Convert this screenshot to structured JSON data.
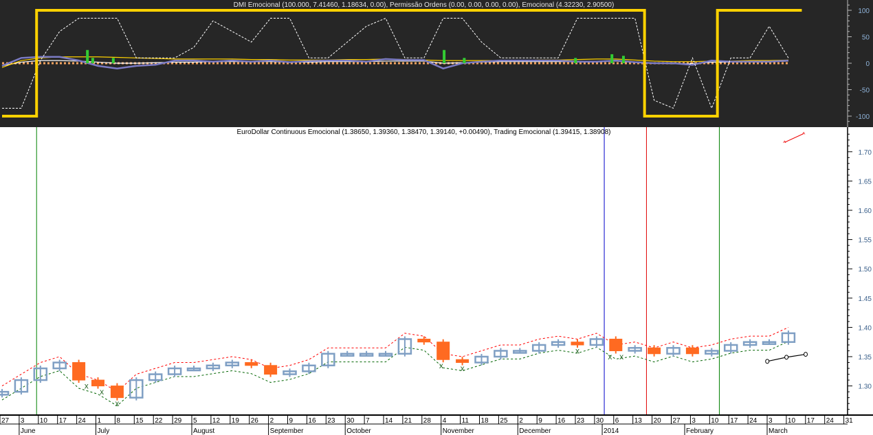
{
  "top_panel": {
    "title": "DMI Emocional (100.000, 7.41460, 1.18634, 0.00), Permissão Ordens (0.00, 0.00, 0.00, 0.00), Emocional (4.32230, 2.90500)"
  },
  "main_panel": {
    "title": "EuroDollar Continuous Emocional (1.38650, 1.39360, 1.38470, 1.39140, +0.00490), Trading Emocional (1.39415, 1.38908)"
  },
  "colors": {
    "dark_bg": "#262626",
    "yellow": "#ffd200",
    "purple": "#7b7bc4",
    "green_bar": "#33cc33",
    "up_candle": "#7f9fc4",
    "down_candle": "#ff6a21",
    "upper_band": "#ff0000",
    "lower_band": "#006400",
    "orange_dots": "#f4a460"
  },
  "chart_data": [
    {
      "type": "line",
      "panel": "indicator",
      "title": "DMI Emocional (100.000, 7.41460, 1.18634, 0.00), Permissão Ordens (0.00, 0.00, 0.00, 0.00), Emocional (4.32230, 2.90500)",
      "ylim": [
        -115,
        115
      ],
      "yticks": [
        "100",
        "50",
        "0",
        "-50",
        "-100"
      ],
      "ytick_values": [
        100,
        50,
        0,
        -50,
        -100
      ],
      "x_unit": "week index from May 27, 2013",
      "series": [
        {
          "name": "Permissão Ordens (step)",
          "segments": [
            {
              "from": 0,
              "to": 1.8,
              "value": -100
            },
            {
              "from": 1.8,
              "to": 33.5,
              "value": 100
            },
            {
              "from": 33.5,
              "to": 37.3,
              "value": -100
            },
            {
              "from": 37.3,
              "to": 41.7,
              "value": 100
            }
          ]
        },
        {
          "name": "DMI dashed",
          "values": [
            -85,
            -85,
            5,
            60,
            85,
            85,
            85,
            10,
            10,
            10,
            30,
            80,
            60,
            40,
            85,
            85,
            10,
            10,
            40,
            70,
            85,
            10,
            10,
            85,
            85,
            40,
            10,
            10,
            10,
            10,
            85,
            85,
            85,
            85,
            -70,
            -85,
            10,
            -85,
            10,
            10,
            70,
            10
          ]
        },
        {
          "name": "Emocional purple",
          "values": [
            -5,
            10,
            12,
            12,
            5,
            -5,
            -10,
            -5,
            -3,
            5,
            5,
            3,
            5,
            3,
            5,
            2,
            4,
            5,
            5,
            3,
            8,
            6,
            6,
            -10,
            0,
            3,
            5,
            5,
            5,
            5,
            3,
            3,
            5,
            2,
            0,
            0,
            -3,
            5,
            3,
            3,
            3,
            5
          ]
        },
        {
          "name": "Emocional yellow",
          "values": [
            -8,
            5,
            10,
            12,
            12,
            12,
            11,
            10,
            9,
            8,
            8,
            8,
            8,
            7,
            7,
            6,
            6,
            6,
            7,
            7,
            8,
            7,
            6,
            5,
            5,
            5,
            5,
            5,
            6,
            6,
            7,
            8,
            8,
            6,
            4,
            3,
            3,
            4,
            4,
            5,
            5,
            6
          ]
        },
        {
          "name": "Emocional white",
          "values": [
            -5,
            2,
            5,
            5,
            4,
            2,
            0,
            0,
            1,
            2,
            2,
            3,
            3,
            3,
            3,
            2,
            2,
            3,
            3,
            3,
            4,
            4,
            4,
            0,
            1,
            2,
            3,
            3,
            3,
            3,
            3,
            3,
            4,
            2,
            0,
            -1,
            -1,
            2,
            2,
            2,
            3,
            4
          ]
        },
        {
          "name": "Zero dotted",
          "values": [
            0,
            0,
            0,
            0,
            0,
            0,
            0,
            0,
            0,
            0,
            0,
            0,
            0,
            0,
            0,
            0,
            0,
            0,
            0,
            0,
            0,
            0,
            0,
            0,
            0,
            0,
            0,
            0,
            0,
            0,
            0,
            0,
            0,
            0,
            0,
            0,
            0,
            0,
            0,
            0,
            0,
            0
          ]
        }
      ],
      "bars": [
        {
          "x": 4.45,
          "value": 25
        },
        {
          "x": 4.73,
          "value": 10
        },
        {
          "x": 5.8,
          "value": 10
        },
        {
          "x": 23.05,
          "value": 25
        },
        {
          "x": 24.1,
          "value": 10
        },
        {
          "x": 29.9,
          "value": 10
        },
        {
          "x": 31.8,
          "value": 17
        },
        {
          "x": 32.4,
          "value": 14
        }
      ]
    },
    {
      "type": "bar",
      "panel": "price",
      "title": "EuroDollar Continuous Emocional (1.38650, 1.39360, 1.38470, 1.39140, +0.00490), Trading Emocional (1.39415, 1.38908)",
      "ylim": [
        1.245,
        1.745
      ],
      "yticks": [
        "1.70",
        "1.65",
        "1.60",
        "1.55",
        "1.50",
        "1.45",
        "1.40",
        "1.35",
        "1.30"
      ],
      "ytick_values": [
        1.7,
        1.65,
        1.6,
        1.55,
        1.5,
        1.45,
        1.4,
        1.35,
        1.3
      ],
      "x_ticks": [
        "27",
        "3",
        "10",
        "17",
        "24",
        "1",
        "8",
        "15",
        "22",
        "29",
        "5",
        "12",
        "19",
        "26",
        "2",
        "9",
        "16",
        "23",
        "30",
        "7",
        "14",
        "21",
        "28",
        "4",
        "11",
        "18",
        "25",
        "2",
        "9",
        "16",
        "23",
        "30",
        "6",
        "13",
        "20",
        "27",
        "3",
        "10",
        "17",
        "24",
        "3",
        "10",
        "17",
        "24",
        "31"
      ],
      "months": [
        {
          "label": "June",
          "week": 1
        },
        {
          "label": "July",
          "week": 5
        },
        {
          "label": "August",
          "week": 10
        },
        {
          "label": "September",
          "week": 14
        },
        {
          "label": "October",
          "week": 18
        },
        {
          "label": "November",
          "week": 23
        },
        {
          "label": "December",
          "week": 27
        },
        {
          "label": "2014",
          "week": 31.4
        },
        {
          "label": "February",
          "week": 35.7
        },
        {
          "label": "March",
          "week": 40
        }
      ],
      "closes": [
        1.29,
        1.31,
        1.33,
        1.34,
        1.31,
        1.3,
        1.28,
        1.31,
        1.32,
        1.33,
        1.33,
        1.335,
        1.34,
        1.335,
        1.32,
        1.325,
        1.335,
        1.355,
        1.355,
        1.355,
        1.355,
        1.38,
        1.375,
        1.345,
        1.34,
        1.35,
        1.36,
        1.36,
        1.37,
        1.375,
        1.37,
        1.38,
        1.36,
        1.365,
        1.355,
        1.365,
        1.355,
        1.36,
        1.37,
        1.375,
        1.375,
        1.39
      ],
      "band_offsets": {
        "upper": 0.01,
        "lower": -0.014
      },
      "signal_x_weeks": [
        4.4,
        5.2,
        6.0,
        22.9,
        24.0,
        30.0,
        31.7,
        32.3
      ],
      "trading_arrows": {
        "weeks": [
          40.8,
          41.8
        ],
        "values": [
          1.716,
          1.731
        ]
      },
      "trading_circles": {
        "weeks": [
          39.9,
          40.9,
          41.9
        ],
        "values": [
          1.342,
          1.349,
          1.354
        ]
      },
      "markers": [
        {
          "week": 1.8,
          "color": "#008000"
        },
        {
          "week": 31.4,
          "color": "#0000cc"
        },
        {
          "week": 33.6,
          "color": "#e00000"
        },
        {
          "week": 37.4,
          "color": "#008000"
        }
      ]
    }
  ]
}
